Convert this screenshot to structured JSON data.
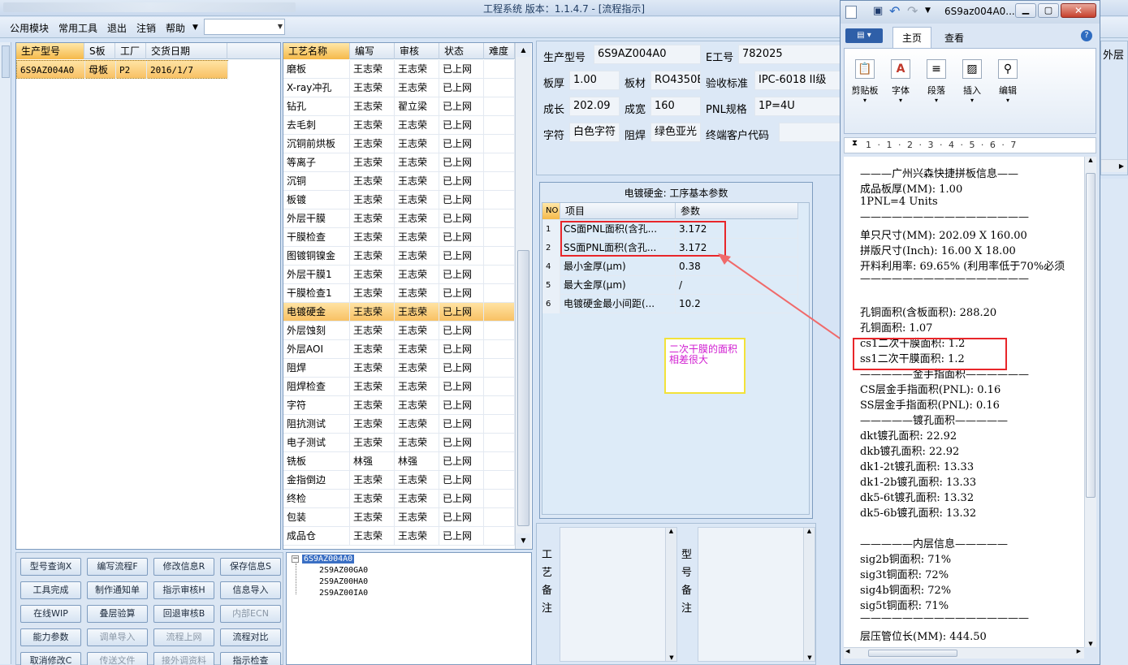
{
  "window": {
    "title": "工程系统  版本：1.1.4.7 - [流程指示]"
  },
  "menu": {
    "items": [
      "公用模块",
      "常用工具",
      "退出",
      "注销",
      "帮助"
    ]
  },
  "left_grid": {
    "headers": [
      "生产型号",
      "S板",
      "工厂",
      "交货日期"
    ],
    "rows": [
      [
        "6S9AZ004A0",
        "母板",
        "P2",
        "2016/1/7"
      ]
    ]
  },
  "process_grid": {
    "headers": [
      "工艺名称",
      "编写",
      "审核",
      "状态",
      "难度"
    ],
    "rows": [
      [
        "磨板",
        "王志荣",
        "王志荣",
        "已上网"
      ],
      [
        "X-ray冲孔",
        "王志荣",
        "王志荣",
        "已上网"
      ],
      [
        "钻孔",
        "王志荣",
        "翟立梁",
        "已上网"
      ],
      [
        "去毛刺",
        "王志荣",
        "王志荣",
        "已上网"
      ],
      [
        "沉铜前烘板",
        "王志荣",
        "王志荣",
        "已上网"
      ],
      [
        "等离子",
        "王志荣",
        "王志荣",
        "已上网"
      ],
      [
        "沉铜",
        "王志荣",
        "王志荣",
        "已上网"
      ],
      [
        "板镀",
        "王志荣",
        "王志荣",
        "已上网"
      ],
      [
        "外层干膜",
        "王志荣",
        "王志荣",
        "已上网"
      ],
      [
        "干膜检查",
        "王志荣",
        "王志荣",
        "已上网"
      ],
      [
        "图镀铜镍金",
        "王志荣",
        "王志荣",
        "已上网"
      ],
      [
        "外层干膜1",
        "王志荣",
        "王志荣",
        "已上网"
      ],
      [
        "干膜检查1",
        "王志荣",
        "王志荣",
        "已上网"
      ],
      [
        "电镀硬金",
        "王志荣",
        "王志荣",
        "已上网"
      ],
      [
        "外层蚀刻",
        "王志荣",
        "王志荣",
        "已上网"
      ],
      [
        "外层AOI",
        "王志荣",
        "王志荣",
        "已上网"
      ],
      [
        "阻焊",
        "王志荣",
        "王志荣",
        "已上网"
      ],
      [
        "阻焊检查",
        "王志荣",
        "王志荣",
        "已上网"
      ],
      [
        "字符",
        "王志荣",
        "王志荣",
        "已上网"
      ],
      [
        "阻抗测试",
        "王志荣",
        "王志荣",
        "已上网"
      ],
      [
        "电子测试",
        "王志荣",
        "王志荣",
        "已上网"
      ],
      [
        "铣板",
        "林强",
        "林强",
        "已上网"
      ],
      [
        "金指倒边",
        "王志荣",
        "王志荣",
        "已上网"
      ],
      [
        "终检",
        "王志荣",
        "王志荣",
        "已上网"
      ],
      [
        "包装",
        "王志荣",
        "王志荣",
        "已上网"
      ],
      [
        "成品仓",
        "王志荣",
        "王志荣",
        "已上网"
      ]
    ],
    "selected": "电镀硬金"
  },
  "buttons": [
    [
      "型号查询X",
      "编写流程F",
      "修改信息R",
      "保存信息S"
    ],
    [
      "工具完成",
      "制作通知单",
      "指示审核H",
      "信息导入"
    ],
    [
      "在线WIP",
      "叠层验算",
      "回退审核B",
      "内部ECN"
    ],
    [
      "能力参数",
      "调单导入",
      "流程上网",
      "流程对比"
    ],
    [
      "取消修改C",
      "传送文件",
      "接外调资料",
      "指示检查"
    ]
  ],
  "tree": {
    "root": "6S9AZ004A0",
    "children": [
      "2S9AZ00GA0",
      "2S9AZ00HA0",
      "2S9AZ00IA0"
    ]
  },
  "info": {
    "prod_model_label": "生产型号",
    "prod_model": "6S9AZ004A0",
    "e_no_label": "E工号",
    "e_no": "782025",
    "thickness_label": "板厚",
    "thickness": "1.00",
    "material_label": "板材",
    "material": "RO4350B",
    "standard_label": "验收标准",
    "standard": "IPC-6018 II级",
    "length_label": "成长",
    "length": "202.09",
    "width_label": "成宽",
    "width": "160",
    "pnl_label": "PNL规格",
    "pnl": "1P=4U",
    "char_label": "字符",
    "char": "白色字符",
    "mask_label": "阻焊",
    "mask": "绿色亚光",
    "customer_label": "终端客户代码",
    "customer": ""
  },
  "param_grid": {
    "title": "电镀硬金: 工序基本参数",
    "headers": [
      "NO",
      "项目",
      "参数"
    ],
    "rows": [
      [
        "1",
        "CS面PNL面积(含孔...",
        "3.172"
      ],
      [
        "2",
        "SS面PNL面积(含孔...",
        "3.172"
      ],
      [
        "4",
        "最小金厚(μm)",
        "0.38"
      ],
      [
        "5",
        "最大金厚(μm)",
        "/"
      ],
      [
        "6",
        "电镀硬金最小间距(...",
        "10.2"
      ]
    ]
  },
  "annotation": {
    "text": "二次干膜的面积相差很大"
  },
  "notes": {
    "process_label": "工艺备注",
    "model_label": "型号备注"
  },
  "right_edge": {
    "text": "外层"
  },
  "word": {
    "title": "6S9az004A0...",
    "tabs": [
      "主页",
      "查看"
    ],
    "groups": [
      "剪贴板",
      "字体",
      "段落",
      "插入",
      "编辑"
    ],
    "ruler": "1 · 1 · 2 · 3 · 4 · 5 · 6 · 7",
    "lines": [
      "———广州兴森快捷拼板信息——",
      "成品板厚(MM): 1.00",
      "1PNL=4 Units",
      "————————————————",
      "单只尺寸(MM): 202.09 X 160.00",
      "拼版尺寸(Inch): 16.00 X 18.00",
      "开料利用率: 69.65% (利用率低于70%必须",
      "————————————————",
      "",
      "孔铜面积(含板面积): 288.20",
      "孔铜面积: 1.07",
      "cs1二次干膜面积: 1.2",
      "ss1二次干膜面积: 1.2",
      "—————金手指面积——————",
      "CS层金手指面积(PNL): 0.16",
      "SS层金手指面积(PNL): 0.16",
      "—————镀孔面积—————",
      "dkt镀孔面积: 22.92",
      "dkb镀孔面积: 22.92",
      "dk1-2t镀孔面积: 13.33",
      "dk1-2b镀孔面积: 13.33",
      "dk5-6t镀孔面积: 13.32",
      "dk5-6b镀孔面积: 13.32",
      "",
      "—————内层信息—————",
      "sig2b铜面积: 71%",
      "sig3t铜面积: 72%",
      "sig4b铜面积: 72%",
      "sig5t铜面积: 71%",
      "————————————————",
      "层压管位长(MM): 444.50"
    ]
  }
}
